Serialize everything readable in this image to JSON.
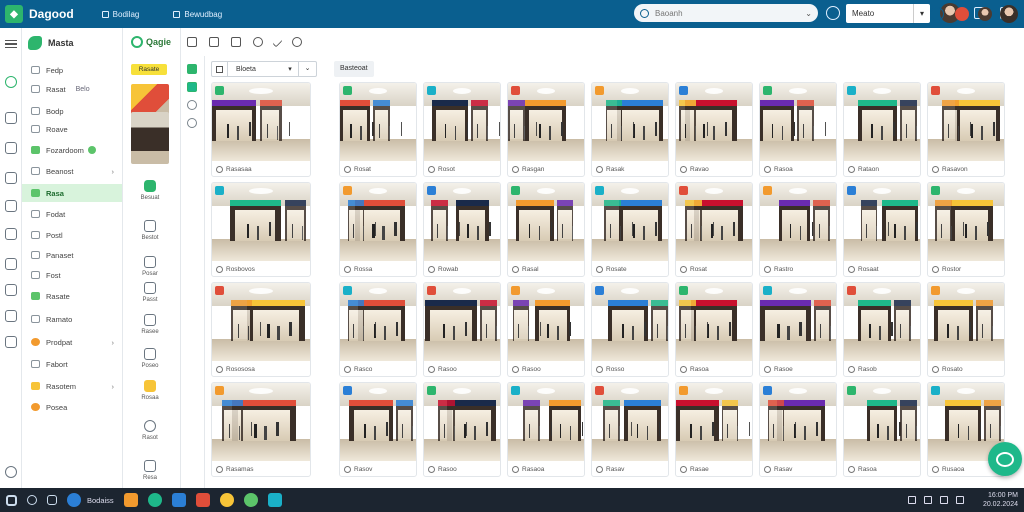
{
  "app": {
    "title": "Dagood"
  },
  "topnav": [
    {
      "label": "Bodilag"
    },
    {
      "label": "Bewudbag"
    }
  ],
  "search": {
    "placeholder": "Baoanh"
  },
  "filter_select": {
    "value": "Meato"
  },
  "nav": {
    "header": "Masta",
    "items": [
      {
        "label": "Fedp",
        "icon": "chat-icon"
      },
      {
        "label": "Rasat",
        "tag": "Belo",
        "icon": "folder-icon"
      },
      {
        "label": "Bodp",
        "icon": "table-icon"
      },
      {
        "label": "Roave",
        "icon": "document-icon"
      },
      {
        "label": "Fozardoom",
        "icon": "leaf-icon",
        "badge": true
      },
      {
        "label": "Beanost",
        "icon": "layers-icon",
        "arrow": "›"
      },
      {
        "label": "Rasa",
        "icon": "grid-icon",
        "active": true
      },
      {
        "label": "Fodat",
        "icon": "chart-icon"
      },
      {
        "label": "Postl",
        "icon": "list-icon"
      },
      {
        "label": "Panaset",
        "icon": "pencil-icon"
      },
      {
        "label": "Fost",
        "icon": "person-icon"
      },
      {
        "label": "Rasate",
        "icon": "image-icon"
      },
      {
        "label": "Ramato",
        "icon": "calendar-icon"
      },
      {
        "label": "Prodpat",
        "icon": "star-icon",
        "arrow": "›"
      },
      {
        "label": "Fabort",
        "icon": "box-icon"
      },
      {
        "label": "Rasotem",
        "icon": "globe-icon",
        "arrow": "›"
      },
      {
        "label": "Posea",
        "icon": "tag-icon"
      }
    ]
  },
  "subpanel": {
    "header": "Qagie",
    "chip": "Rasate",
    "items": [
      {
        "label": "Besuat",
        "icon": "leaf-icon"
      },
      {
        "label": "Bestot",
        "icon": "home-icon"
      },
      {
        "label": "Posar",
        "icon": "note-icon"
      },
      {
        "label": "Passt",
        "icon": "hand-icon"
      },
      {
        "label": "Rasee",
        "icon": "triangle-icon"
      },
      {
        "label": "Poseo",
        "icon": "layers-icon"
      },
      {
        "label": "Rosaa",
        "icon": "badge-icon"
      },
      {
        "label": "Rasot",
        "icon": "pin-icon"
      },
      {
        "label": "Resa",
        "icon": "box-icon"
      }
    ]
  },
  "filterbar": {
    "label": "Bloeta"
  },
  "gallery": {
    "label": "Basteoat",
    "left_captions": [
      "Rasasaa",
      "Rosbovos",
      "Rosososa",
      "Rasamas"
    ],
    "captions": [
      "Rosat",
      "Rosot",
      "Rasgan",
      "Rasak",
      "Ravao",
      "Rasoa",
      "Rataon",
      "Rasavon",
      "Rossa",
      "Rowab",
      "Rasal",
      "Rosate",
      "Rosat",
      "Rastro",
      "Rosaat",
      "Rostor",
      "Rasco",
      "Rasoo",
      "Rasoo",
      "Rosso",
      "Rasoa",
      "Rasoe",
      "Rasob",
      "Rosato",
      "Rasov",
      "Rasoo",
      "Rasaoa",
      "Rasav",
      "Rasae",
      "Rasav",
      "Rasoa",
      "Rusaoa"
    ]
  },
  "taskbar": {
    "label": "Bodaiss",
    "time": "16:00 PM",
    "date": "20.02.2024"
  }
}
